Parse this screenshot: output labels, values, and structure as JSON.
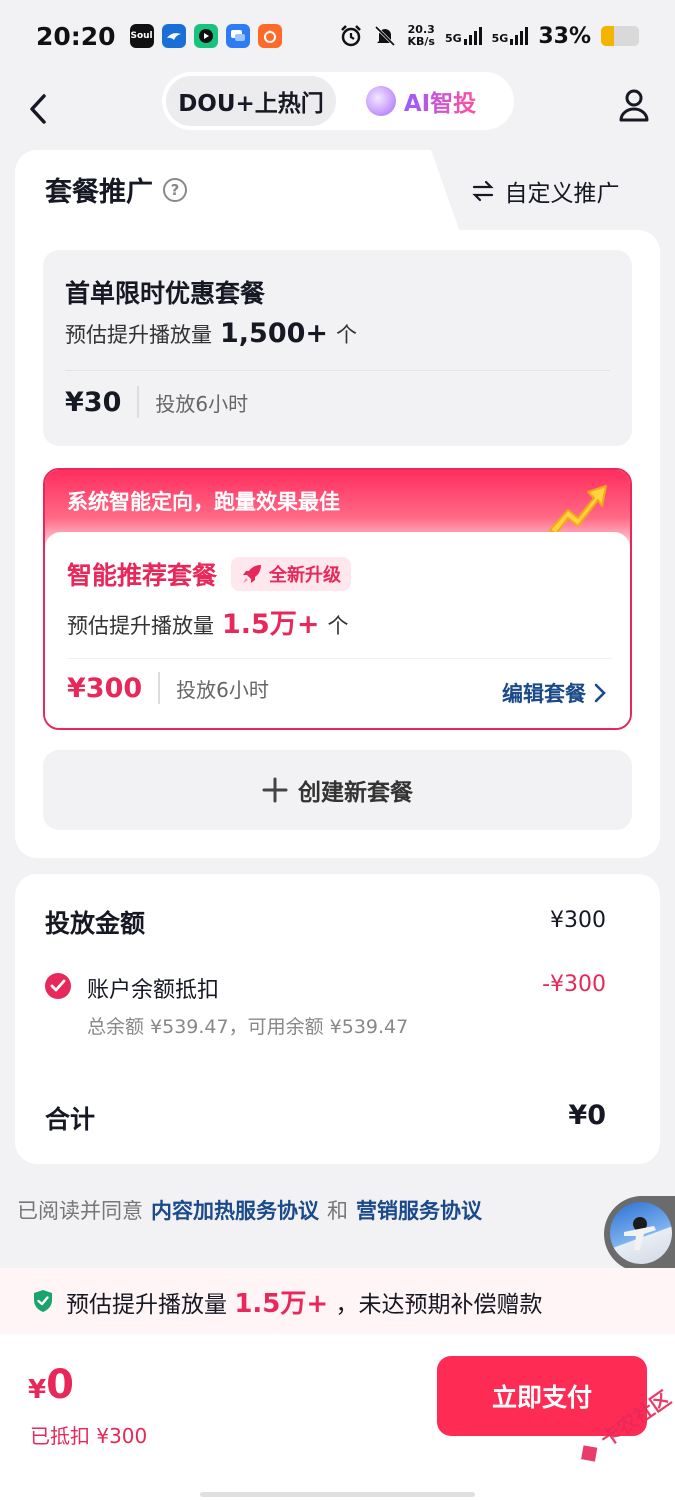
{
  "status_bar": {
    "time": "20:20",
    "net_speed_value": "20.3",
    "net_speed_unit": "KB/s",
    "signal1": "5G",
    "signal2": "5G",
    "battery": "33%",
    "battery_level": 0.33,
    "apps": [
      {
        "icon": "soul-app-icon",
        "label": "Soul",
        "color": "#111111"
      },
      {
        "icon": "bird-app-icon",
        "label": "",
        "color": "#1a6fd6"
      },
      {
        "icon": "play-app-icon",
        "label": "",
        "color": "#19c37d"
      },
      {
        "icon": "chat-app-icon",
        "label": "",
        "color": "#2d7cf6"
      },
      {
        "icon": "orange-app-icon",
        "label": "",
        "color": "#ff6a2b"
      }
    ]
  },
  "header": {
    "tab_dou": "DOU+上热门",
    "tab_ai": "AI智投"
  },
  "package": {
    "tab_package": "套餐推广",
    "tab_custom": "自定义推广",
    "basic": {
      "title": "首单限时优惠套餐",
      "est_prefix": "预估提升播放量",
      "est_value": "1,500+",
      "est_unit": "个",
      "price": "¥30",
      "duration": "投放6小时"
    },
    "recommended": {
      "banner": "系统智能定向，跑量效果最佳",
      "title": "智能推荐套餐",
      "badge": "全新升级",
      "est_prefix": "预估提升播放量",
      "est_value": "1.5万+",
      "est_unit": "个",
      "price": "¥300",
      "duration": "投放6小时",
      "edit": "编辑套餐"
    },
    "create": "创建新套餐"
  },
  "payment": {
    "amount_label": "投放金额",
    "amount_value": "¥300",
    "deduct_label": "账户余额抵扣",
    "deduct_value": "-¥300",
    "balance_text": "总余额 ¥539.47，可用余额 ¥539.47",
    "total_label": "合计",
    "total_value": "¥0"
  },
  "agreement": {
    "prefix": "已阅读并同意",
    "link1": "内容加热服务协议",
    "and": "和",
    "link2": "营销服务协议"
  },
  "guarantee": {
    "prefix": "预估提升播放量",
    "value": "1.5万+",
    "suffix": "，未达预期补偿赠款"
  },
  "bottom": {
    "currency": "¥",
    "amount": "0",
    "deducted": "已抵扣 ¥300",
    "pay_button": "立即支付"
  },
  "watermark": "卡农社区",
  "colors": {
    "accent": "#fe2c55",
    "link": "#1a4a8a"
  }
}
